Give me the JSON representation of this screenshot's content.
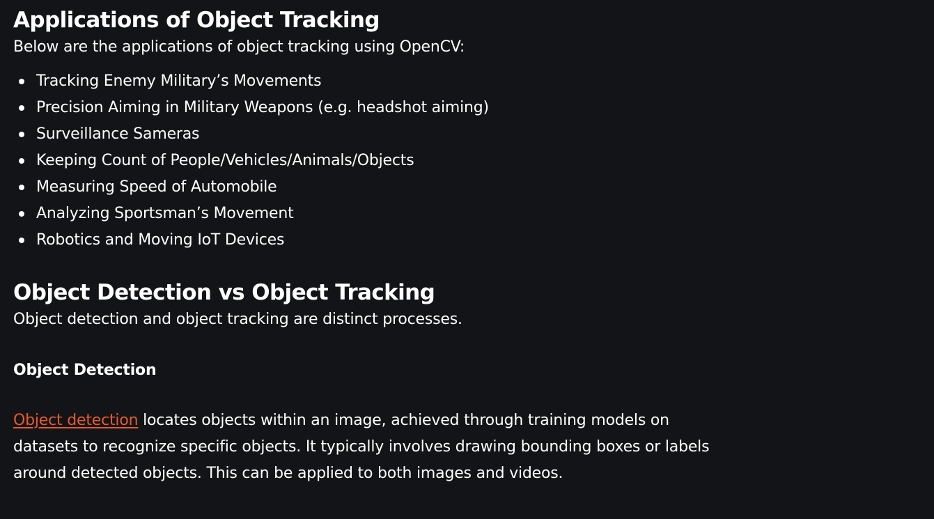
{
  "sections": {
    "applications": {
      "heading": "Applications of Object Tracking",
      "intro": "Below are the applications of object tracking using OpenCV:",
      "items": [
        "Tracking Enemy Military’s Movements",
        "Precision Aiming in Military Weapons (e.g. headshot aiming)",
        "Surveillance Sameras",
        "Keeping Count of People/Vehicles/Animals/Objects",
        "Measuring Speed of Automobile",
        "Analyzing Sportsman’s Movement",
        "Robotics and Moving IoT Devices"
      ]
    },
    "comparison": {
      "heading": "Object Detection vs Object Tracking",
      "intro": "Object detection and object tracking are distinct processes.",
      "subheading": "Object Detection",
      "link_text": "Object detection",
      "line1_rest": " locates objects within an image, achieved through training models on",
      "line2": "datasets to recognize specific objects. It typically involves drawing bounding boxes or labels",
      "line3": "around detected objects. This can be applied to both images and videos."
    }
  },
  "colors": {
    "background": "#131417",
    "text": "#ffffff",
    "link": "#e45b2c"
  }
}
